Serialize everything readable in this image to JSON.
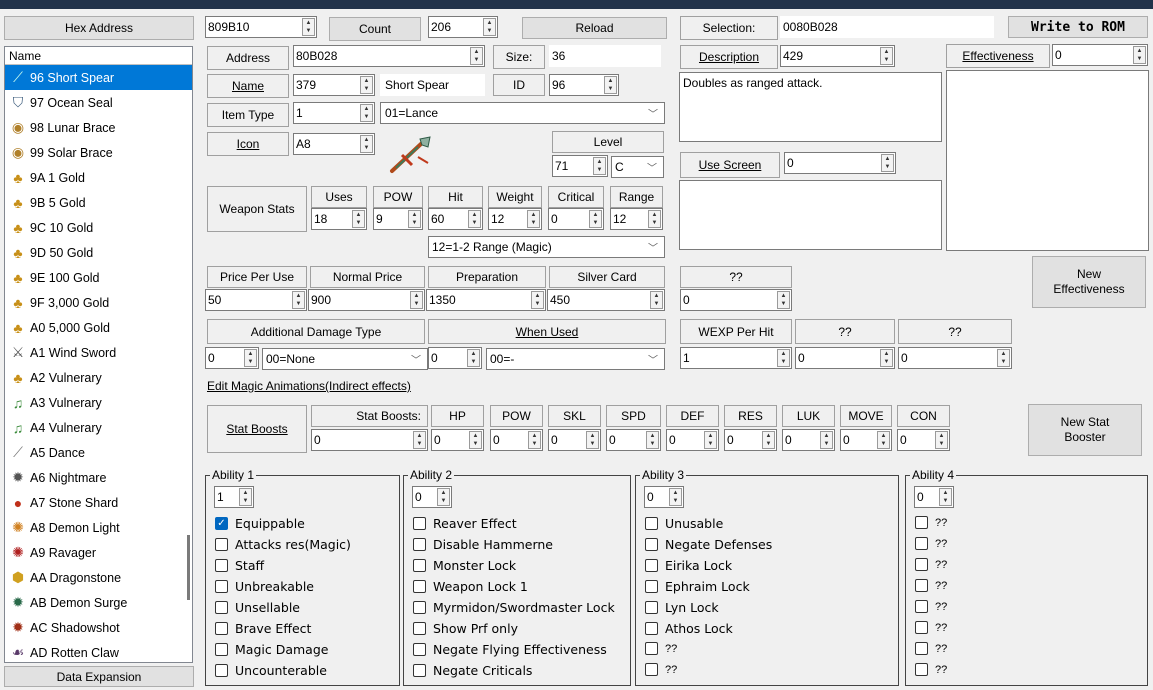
{
  "top": {
    "hex_address_btn": "Hex Address",
    "hex_value": "809B10",
    "count_btn": "Count",
    "count_value": "206",
    "reload_btn": "Reload",
    "selection_label": "Selection:",
    "selection_value": "0080B028",
    "write_btn": "Write to ROM"
  },
  "list": {
    "header": "Name",
    "items": [
      {
        "label": "96 Short Spear",
        "icon": "spear-icon"
      },
      {
        "label": "97 Ocean Seal",
        "icon": "seal-icon"
      },
      {
        "label": "98 Lunar Brace",
        "icon": "brace-icon"
      },
      {
        "label": "99 Solar Brace",
        "icon": "brace-icon"
      },
      {
        "label": "9A 1 Gold",
        "icon": "gold-bag-icon"
      },
      {
        "label": "9B 5 Gold",
        "icon": "gold-bag-icon"
      },
      {
        "label": "9C 10 Gold",
        "icon": "gold-bag-icon"
      },
      {
        "label": "9D 50 Gold",
        "icon": "gold-bag-icon"
      },
      {
        "label": "9E 100 Gold",
        "icon": "gold-bag-icon"
      },
      {
        "label": "9F 3,000 Gold",
        "icon": "gold-bag-icon"
      },
      {
        "label": "A0 5,000 Gold",
        "icon": "gold-bag-icon"
      },
      {
        "label": "A1 Wind Sword",
        "icon": "sword-icon"
      },
      {
        "label": "A2 Vulnerary",
        "icon": "vulnerary-icon"
      },
      {
        "label": "A3 Vulnerary",
        "icon": "music-note-icon"
      },
      {
        "label": "A4 Vulnerary",
        "icon": "music-note-icon"
      },
      {
        "label": "A5 Dance",
        "icon": "dance-icon"
      },
      {
        "label": "A6 Nightmare",
        "icon": "nightmare-icon"
      },
      {
        "label": "A7 Stone Shard",
        "icon": "stone-icon"
      },
      {
        "label": "A8 Demon Light",
        "icon": "demon-light-icon"
      },
      {
        "label": "A9 Ravager",
        "icon": "ravager-icon"
      },
      {
        "label": "AA Dragonstone",
        "icon": "dragonstone-icon"
      },
      {
        "label": "AB Demon Surge",
        "icon": "surge-icon"
      },
      {
        "label": "AC Shadowshot",
        "icon": "shadowshot-icon"
      },
      {
        "label": "AD Rotten Claw",
        "icon": "claw-icon"
      }
    ],
    "data_expansion_btn": "Data Expansion"
  },
  "item": {
    "address_label": "Address",
    "address_value": "80B028",
    "size_label": "Size:",
    "size_value": "36",
    "name_label": "Name",
    "name_id": "379",
    "name_text": "Short Spear",
    "id_label": "ID",
    "id_value": "96",
    "item_type_label": "Item Type",
    "item_type_value": "1",
    "item_type_select": "01=Lance",
    "icon_label": "Icon",
    "icon_value": "A8",
    "level_label": "Level",
    "level_value": "71",
    "level_select": "C",
    "weapon_stats_label": "Weapon Stats",
    "stat_headers": [
      "Uses",
      "POW",
      "Hit",
      "Weight",
      "Critical",
      "Range"
    ],
    "stat_values": [
      "18",
      "9",
      "60",
      "12",
      "0",
      "12"
    ],
    "range_select": "12=1-2 Range (Magic)",
    "price_headers": [
      "Price Per Use",
      "Normal Price",
      "Preparation",
      "Silver Card"
    ],
    "price_values": [
      "50",
      "900",
      "1350",
      "450"
    ],
    "qq_label": "??",
    "qq_value": "0",
    "add_damage_label": "Additional Damage Type",
    "add_damage_value": "0",
    "add_damage_select": "00=None",
    "when_used_label": "When Used",
    "when_used_value": "0",
    "when_used_select": "00=-",
    "wexp_label": "WEXP Per Hit",
    "wexp_value": "1",
    "qq2_label": "??",
    "qq2_value": "0",
    "qq3_label": "??",
    "qq3_value": "0",
    "edit_magic_link": "Edit Magic Animations(Indirect effects)",
    "stat_boosts_label": "Stat Boosts",
    "stat_boosts_sub": "Stat Boosts:",
    "stat_boosts_value": "0",
    "boost_headers": [
      "HP",
      "POW",
      "SKL",
      "SPD",
      "DEF",
      "RES",
      "LUK",
      "MOVE",
      "CON"
    ],
    "boost_values": [
      "0",
      "0",
      "0",
      "0",
      "0",
      "0",
      "0",
      "0",
      "0"
    ],
    "new_stat_booster": "New Stat Booster"
  },
  "right": {
    "description_label": "Description",
    "description_value": "429",
    "description_text": "Doubles as ranged attack.",
    "use_screen_label": "Use Screen",
    "use_screen_value": "0",
    "effectiveness_label": "Effectiveness",
    "effectiveness_value": "0",
    "new_effectiveness": "New Effectiveness"
  },
  "abilities": [
    {
      "legend": "Ability 1",
      "value": "1",
      "items": [
        {
          "label": "Equippable",
          "checked": true
        },
        {
          "label": "Attacks res(Magic)",
          "checked": false
        },
        {
          "label": "Staff",
          "checked": false
        },
        {
          "label": "Unbreakable",
          "checked": false
        },
        {
          "label": "Unsellable",
          "checked": false
        },
        {
          "label": "Brave Effect",
          "checked": false
        },
        {
          "label": "Magic Damage",
          "checked": false
        },
        {
          "label": "Uncounterable",
          "checked": false
        }
      ]
    },
    {
      "legend": "Ability 2",
      "value": "0",
      "items": [
        {
          "label": "Reaver Effect",
          "checked": false
        },
        {
          "label": "Disable Hammerne",
          "checked": false
        },
        {
          "label": "Monster Lock",
          "checked": false
        },
        {
          "label": "Weapon Lock 1",
          "checked": false
        },
        {
          "label": "Myrmidon/Swordmaster Lock",
          "checked": false
        },
        {
          "label": "Show Prf only",
          "checked": false
        },
        {
          "label": "Negate Flying Effectiveness",
          "checked": false
        },
        {
          "label": "Negate Criticals",
          "checked": false
        }
      ]
    },
    {
      "legend": "Ability 3",
      "value": "0",
      "items": [
        {
          "label": "Unusable",
          "checked": false
        },
        {
          "label": "Negate Defenses",
          "checked": false
        },
        {
          "label": "Eirika Lock",
          "checked": false
        },
        {
          "label": "Ephraim Lock",
          "checked": false
        },
        {
          "label": "Lyn Lock",
          "checked": false
        },
        {
          "label": "Athos Lock",
          "checked": false
        },
        {
          "label": "??",
          "checked": false
        },
        {
          "label": "??",
          "checked": false
        }
      ]
    },
    {
      "legend": "Ability 4",
      "value": "0",
      "items": [
        {
          "label": "??",
          "checked": false
        },
        {
          "label": "??",
          "checked": false
        },
        {
          "label": "??",
          "checked": false
        },
        {
          "label": "??",
          "checked": false
        },
        {
          "label": "??",
          "checked": false
        },
        {
          "label": "??",
          "checked": false
        },
        {
          "label": "??",
          "checked": false
        },
        {
          "label": "??",
          "checked": false
        }
      ]
    }
  ]
}
